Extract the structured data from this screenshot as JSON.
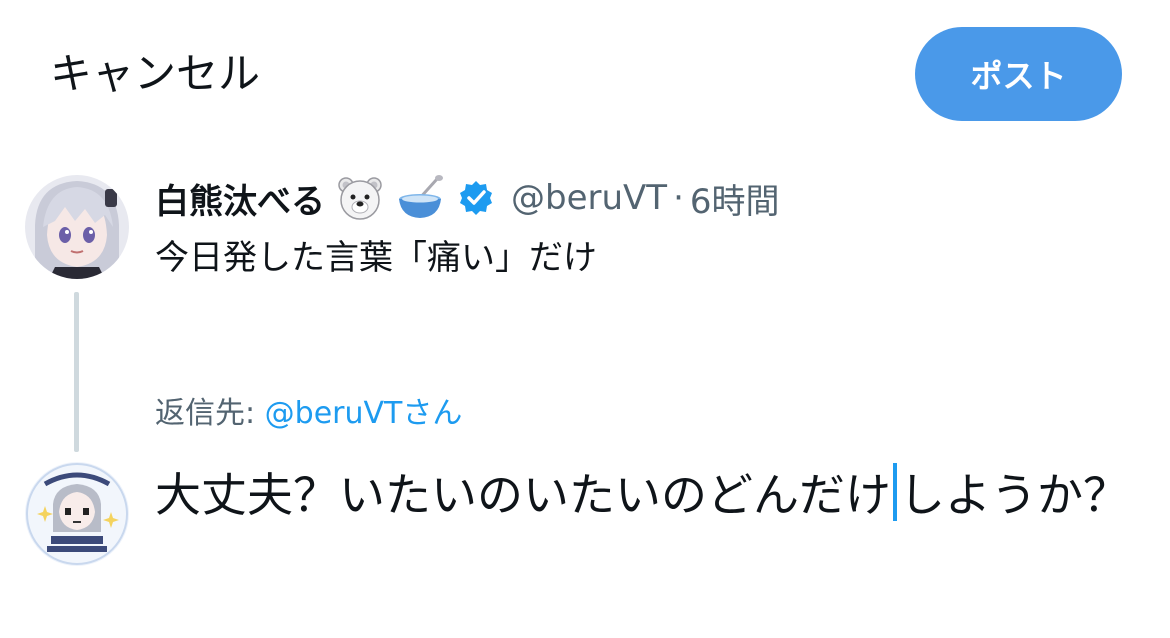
{
  "header": {
    "cancel_label": "キャンセル",
    "post_label": "ポスト",
    "post_color": "#4a99e9"
  },
  "original_post": {
    "avatar_icon": "anime-girl-avatar-icon",
    "display_name": "白熊汰べる",
    "name_emojis": [
      "polar-bear-emoji-icon",
      "bowl-with-spoon-emoji-icon"
    ],
    "verified_icon": "verified-badge-icon",
    "handle": "@beruVT",
    "separator": "·",
    "time": "6時間",
    "text": "今日発した言葉「痛い」だけ"
  },
  "reply": {
    "reply_to_prefix": "返信先: ",
    "reply_to_handle": "@beruVT",
    "reply_to_suffix": "さん",
    "avatar_icon": "anime-girl-sticker-avatar-icon",
    "text_before_caret": "大丈夫？いたいのいたいのどんだけ",
    "text_after_caret": "しようか？"
  },
  "colors": {
    "accent": "#1d9bf0",
    "secondary_text": "#536471",
    "thread_line": "#cfd9de"
  }
}
